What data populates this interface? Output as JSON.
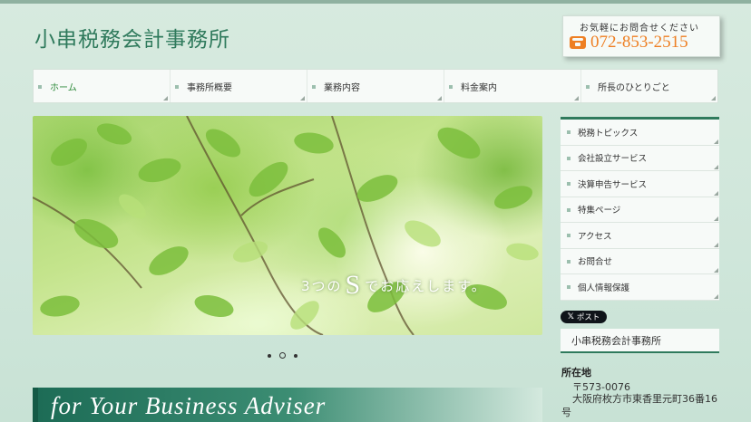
{
  "header": {
    "site_title": "小串税務会計事務所",
    "contact_caption": "お気軽にお問合せください",
    "phone": "072-853-2515"
  },
  "nav": {
    "items": [
      {
        "label": "ホーム",
        "active": true
      },
      {
        "label": "事務所概要"
      },
      {
        "label": "業務内容"
      },
      {
        "label": "料金案内"
      },
      {
        "label": "所長のひとりごと"
      }
    ]
  },
  "hero": {
    "caption_pre": "3つの",
    "caption_big": "S",
    "caption_post": "でお応えします。",
    "slide_count": 3,
    "active_slide": 2
  },
  "tagline": "for Your Business Adviser",
  "sidebar": {
    "items": [
      {
        "label": "税務トピックス"
      },
      {
        "label": "会社設立サービス"
      },
      {
        "label": "決算申告サービス"
      },
      {
        "label": "特集ページ"
      },
      {
        "label": "アクセス"
      },
      {
        "label": "お問合せ"
      },
      {
        "label": "個人情報保護"
      }
    ],
    "x_post_label": "ポスト",
    "office_name": "小串税務会計事務所",
    "address_heading": "所在地",
    "postal_code": "〒573-0076",
    "address": "大阪府枚方市東香里元町36番16号"
  },
  "colors": {
    "brand_green": "#2f7a5c",
    "phone_orange": "#ee7f23"
  }
}
